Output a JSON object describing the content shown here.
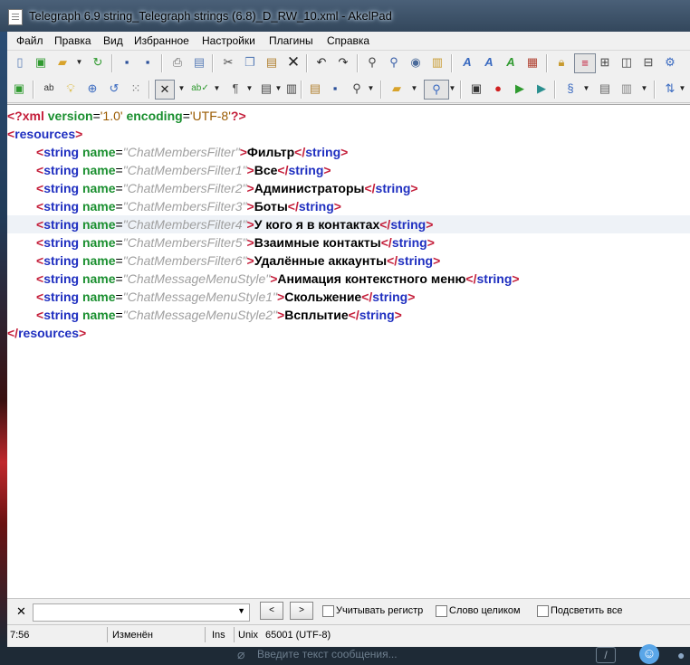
{
  "window": {
    "title": "Telegraph 6.9 string_Telegraph strings (6.8)_D_RW_10.xml - AkelPad"
  },
  "menu": [
    "Файл",
    "Правка",
    "Вид",
    "Избранное",
    "Настройки",
    "Плагины",
    "Справка"
  ],
  "editor": {
    "xml_decl": {
      "open": "<?xml",
      "version_attr": "version",
      "version_value": "'1.0'",
      "encoding_attr": "encoding",
      "encoding_value": "'UTF-8'",
      "close": "?>"
    },
    "root_tag": "resources",
    "child_tag": "string",
    "attr_name": "name",
    "current_line_index": 4,
    "strings": [
      {
        "name": "ChatMembersFilter",
        "text": "Фильтр"
      },
      {
        "name": "ChatMembersFilter1",
        "text": "Все"
      },
      {
        "name": "ChatMembersFilter2",
        "text": "Администраторы"
      },
      {
        "name": "ChatMembersFilter3",
        "text": "Боты"
      },
      {
        "name": "ChatMembersFilter4",
        "text": "У кого я в контактах"
      },
      {
        "name": "ChatMembersFilter5",
        "text": "Взаимные контакты"
      },
      {
        "name": "ChatMembersFilter6",
        "text": "Удалённые аккаунты"
      },
      {
        "name": "ChatMessageMenuStyle",
        "text": "Анимация контекстного меню"
      },
      {
        "name": "ChatMessageMenuStyle1",
        "text": "Скольжение"
      },
      {
        "name": "ChatMessageMenuStyle2",
        "text": "Всплытие"
      }
    ]
  },
  "search": {
    "close_label": "✕",
    "prev_label": "<",
    "next_label": ">",
    "match_case_label": "Учитывать регистр",
    "whole_word_label": "Слово целиком",
    "highlight_all_label": "Подсветить все",
    "match_case_checked": false,
    "whole_word_checked": false,
    "highlight_all_checked": false
  },
  "status": {
    "position": "7:56",
    "modified": "Изменён",
    "insert_mode": "Ins",
    "newline": "Unix",
    "codepage": "65001 (UTF-8)"
  },
  "background_app": {
    "message_placeholder": "Введите текст сообщения..."
  },
  "colors": {
    "bracket": "#c41e3a",
    "tag": "#1f2fc0",
    "attribute": "#1a8f2f",
    "attr_value": "#a0a0a0",
    "current_line": "#eef2f7"
  },
  "icons": {
    "toolbar1": [
      "new-file-icon",
      "new-window-icon",
      "open-icon",
      "open-dropdown-icon",
      "reopen-icon",
      "save-icon",
      "save-all-icon",
      "print-icon",
      "print-preview-icon",
      "cut-icon",
      "copy-icon",
      "paste-icon",
      "delete-icon",
      "undo-icon",
      "redo-icon",
      "find-icon",
      "replace-icon",
      "go-to-icon",
      "insert-date-icon",
      "font-icon",
      "font-color-icon",
      "bg-color-icon",
      "color-table-icon",
      "read-only-icon",
      "word-wrap-icon",
      "split-window-4-icon",
      "split-window-v-icon",
      "split-window-h-icon",
      "settings-icon"
    ],
    "toolbar2": [
      "plugin-icon",
      "coder-icon",
      "hint-icon",
      "sessions-icon",
      "format-icon",
      "code-fold-icon",
      "spell-check-icon",
      "pilcrow-icon",
      "list-icon",
      "outline-icon",
      "clipboard-icon",
      "save-session-icon",
      "preview-icon",
      "open-folder-icon",
      "browse-icon",
      "record-icon",
      "play-icon",
      "play-to-end-icon",
      "script-icon",
      "scripts-icon",
      "sort-icon"
    ]
  }
}
